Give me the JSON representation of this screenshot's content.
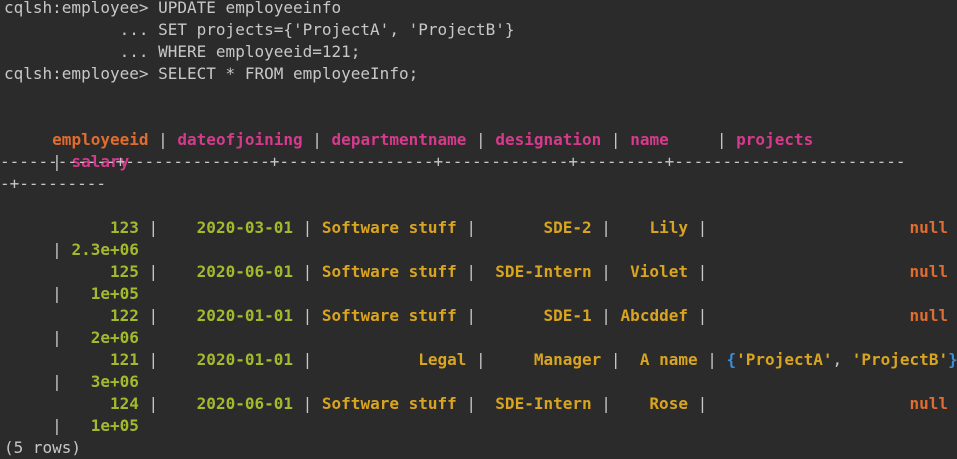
{
  "terminal": {
    "commands": [
      "cqlsh:employee> UPDATE employeeinfo",
      "            ... SET projects={'ProjectA', 'ProjectB'}",
      "            ... WHERE employeeid=121;",
      "cqlsh:employee> SELECT * FROM employeeInfo;"
    ],
    "header": {
      "line1": {
        "prefix": " ",
        "employeeid": "employeeid",
        "sep1": " | ",
        "dateofjoining": "dateofjoining",
        "sep2": " | ",
        "departmentname": "departmentname",
        "sep3": " | ",
        "designation": "designation",
        "sep4": " | ",
        "name": "name",
        "sep5": "     | ",
        "projects": "projects"
      },
      "line2": {
        "prefix": " | ",
        "salary": "salary"
      }
    },
    "divider_line1": "------------+---------------+----------------+-------------+---------+------------------------",
    "divider_line2": "-+---------",
    "rows": [
      {
        "employeeid": "123",
        "dateofjoining": "2020-03-01",
        "departmentname": "Software stuff",
        "designation": "SDE-2",
        "name": "Lily",
        "projects": "null",
        "salary": "2.3e+06"
      },
      {
        "employeeid": "125",
        "dateofjoining": "2020-06-01",
        "departmentname": "Software stuff",
        "designation": "SDE-Intern",
        "name": "Violet",
        "projects": "null",
        "salary": "1e+05"
      },
      {
        "employeeid": "122",
        "dateofjoining": "2020-01-01",
        "departmentname": "Software stuff",
        "designation": "SDE-1",
        "name": "Abcddef",
        "projects": "null",
        "salary": "2e+06"
      },
      {
        "employeeid": "121",
        "dateofjoining": "2020-01-01",
        "departmentname": "Legal",
        "designation": "Manager",
        "name": "A name",
        "projects_set": {
          "open": "{",
          "item1": "'ProjectA'",
          "sep": ", ",
          "item2": "'ProjectB'",
          "close": "}"
        },
        "salary": "3e+06"
      },
      {
        "employeeid": "124",
        "dateofjoining": "2020-06-01",
        "departmentname": "Software stuff",
        "designation": "SDE-Intern",
        "name": "Rose",
        "projects": "null",
        "salary": "1e+05"
      }
    ],
    "footer": "(5 rows)"
  }
}
